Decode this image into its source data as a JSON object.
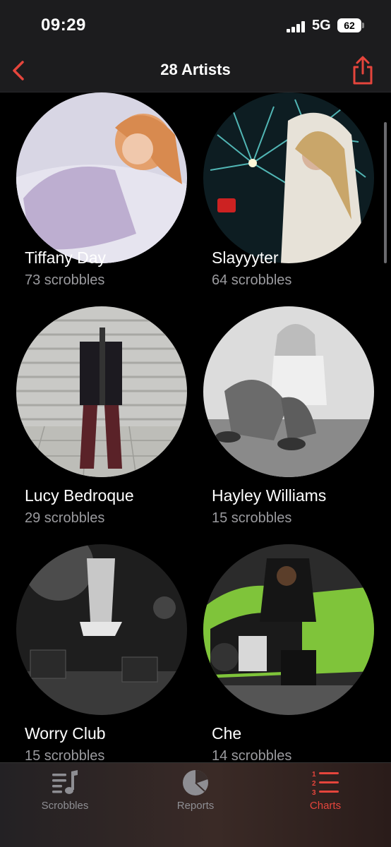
{
  "status": {
    "time": "09:29",
    "network": "5G",
    "battery": "62"
  },
  "nav": {
    "title": "28 Artists"
  },
  "artists": [
    {
      "name": "Tiffany Day",
      "scrobbles": "73 scrobbles"
    },
    {
      "name": "Slayyyter",
      "scrobbles": "64 scrobbles"
    },
    {
      "name": "Lucy Bedroque",
      "scrobbles": "29 scrobbles"
    },
    {
      "name": "Hayley Williams",
      "scrobbles": "15 scrobbles"
    },
    {
      "name": "Worry Club",
      "scrobbles": "15 scrobbles"
    },
    {
      "name": "Che",
      "scrobbles": "14 scrobbles"
    }
  ],
  "tabs": [
    {
      "label": "Scrobbles",
      "icon": "music-list-icon",
      "active": false
    },
    {
      "label": "Reports",
      "icon": "pie-chart-icon",
      "active": false
    },
    {
      "label": "Charts",
      "icon": "ranked-list-icon",
      "active": true
    }
  ],
  "colors": {
    "accent": "#e5453c",
    "background": "#000000",
    "bar": "#1c1c1e",
    "secondary_text": "#9a9a9e"
  }
}
